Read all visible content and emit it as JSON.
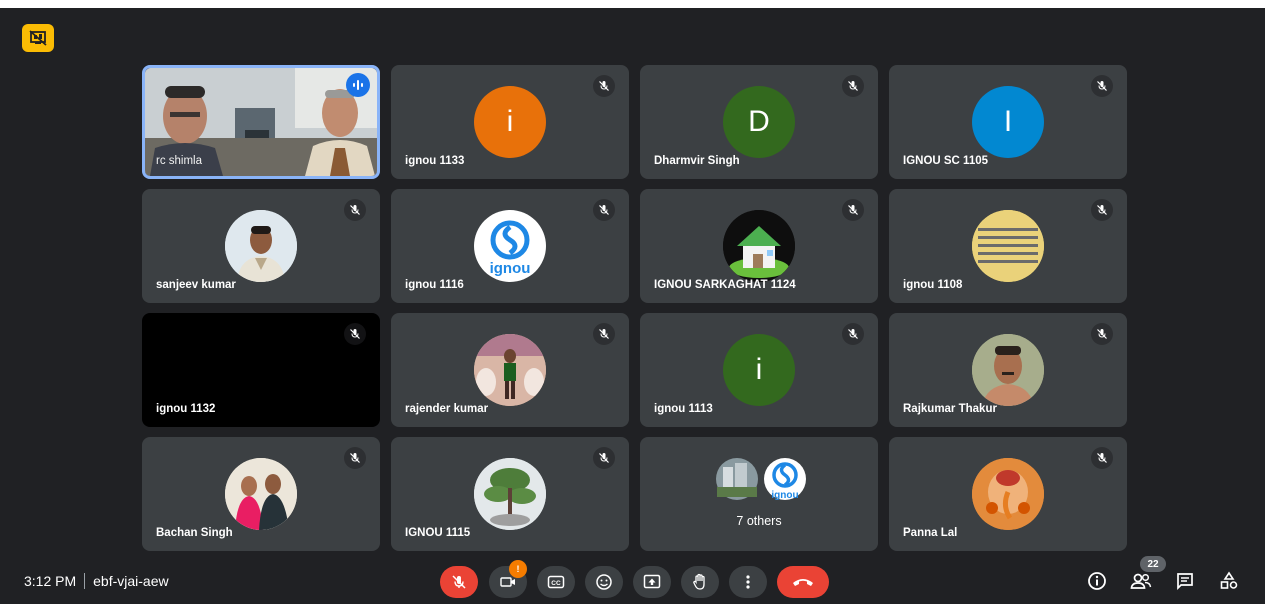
{
  "meeting": {
    "time": "3:12 PM",
    "code": "ebf-vjai-aew",
    "people_count": "22"
  },
  "tiles": [
    {
      "name": "rc shimla",
      "type": "video"
    },
    {
      "name": "ignou 1133",
      "letter": "i",
      "avatar_color": "#e8710a"
    },
    {
      "name": "Dharmvir Singh",
      "letter": "D",
      "avatar_color": "#33691e"
    },
    {
      "name": "IGNOU SC 1105",
      "letter": "I",
      "avatar_color": "#0288d1"
    },
    {
      "name": "sanjeev kumar",
      "type": "photo"
    },
    {
      "name": "ignou 1116",
      "type": "logo"
    },
    {
      "name": "IGNOU SARKAGHAT 1124",
      "type": "house"
    },
    {
      "name": "ignou 1108",
      "type": "photo"
    },
    {
      "name": "ignou 1132",
      "type": "black"
    },
    {
      "name": "rajender kumar",
      "type": "photo"
    },
    {
      "name": "ignou 1113",
      "letter": "i",
      "avatar_color": "#33691e"
    },
    {
      "name": "Rajkumar Thakur",
      "type": "photo"
    },
    {
      "name": "Bachan Singh",
      "type": "photo"
    },
    {
      "name": "IGNOU 1115",
      "type": "photo"
    },
    {
      "name": "7 others",
      "type": "others"
    },
    {
      "name": "Panna Lal",
      "type": "photo"
    }
  ],
  "logo_text": "ignou",
  "camera_badge": "!",
  "colors": {
    "background": "#202124",
    "tile": "#3c4043",
    "accent_red": "#ea4335",
    "active_outline": "#8ab4f8",
    "status_chip": "#fbbc04"
  }
}
